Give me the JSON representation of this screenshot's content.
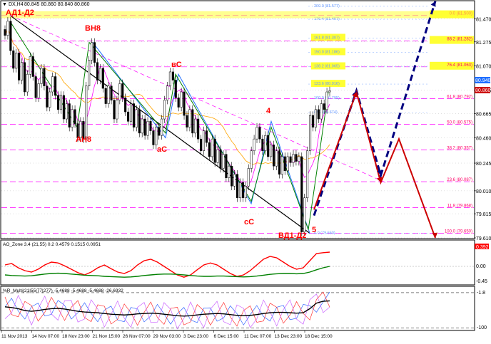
{
  "header": {
    "symbol": "DX,H4",
    "ohlc": "80.845 80.860 80.840 80.860",
    "symbol_icon": "triangle-down-icon"
  },
  "colors": {
    "background": "#ffffff",
    "candle": "#000000",
    "grid": "#c0c0c0",
    "fib_line": "#ff00ff",
    "fib_label": "#ff0066",
    "upper_fib_label": "#6699ff",
    "highlight_yellow": "#ffff33",
    "wave_label": "#ff0000",
    "trend_black": "#000000",
    "trend_blue": "#1e6eff",
    "green_wave": "#008000",
    "projection_blue": "#000080",
    "projection_red": "#cc0000",
    "ma_fast": "#ff00ff",
    "ma_slow": "#ffa500",
    "price_tag": "#1e6eff",
    "price_tag_red": "#cc0000"
  },
  "price_axis": {
    "labels": [
      "81.470",
      "81.275",
      "81.070",
      "80.865",
      "80.665",
      "80.460",
      "80.245",
      "80.010",
      "79.815",
      "79.610"
    ],
    "current_price": "80.940",
    "current_price_red": "80.860"
  },
  "time_axis": {
    "labels": [
      "11 Nov 2013",
      "14 Nov 07:00",
      "18 Nov 23:00",
      "21 Nov 15:00",
      "26 Nov 07:00",
      "29 Nov 03:00",
      "3 Dec 23:00",
      "6 Dec 15:00",
      "11 Dec 07:00",
      "13 Dec 23:00",
      "18 Dec 15:00"
    ]
  },
  "fib_levels": [
    {
      "label": "0.0 (81.500)",
      "highlight": true
    },
    {
      "label": "88.2 (81.282)",
      "highlight": true
    },
    {
      "label": "76.4 (81.063)",
      "highlight": true
    },
    {
      "label": "61.8 (80.792)",
      "highlight": false
    },
    {
      "label": "50.0 (80.575)",
      "highlight": false
    },
    {
      "label": "38.2 (80.357)",
      "highlight": false
    },
    {
      "label": "23.6 (80.087)",
      "highlight": false
    },
    {
      "label": "11.8 (79.868)",
      "highlight": false
    },
    {
      "label": "100.0 (79.650)",
      "highlight": false
    }
  ],
  "upper_fib_levels": [
    {
      "label": "200.0 (81.577)",
      "highlight": false
    },
    {
      "label": "176.4 (81.467)",
      "highlight": false
    },
    {
      "label": "161.8 (81.307)",
      "highlight": true
    },
    {
      "label": "150.0 (81.186)",
      "highlight": true
    },
    {
      "label": "138.2 (81.065)",
      "highlight": true
    },
    {
      "label": "123.6 (80.916)",
      "highlight": true
    },
    {
      "label": "100.0 (80.795)",
      "highlight": false
    },
    {
      "label": "88.2 (80.674)",
      "highlight": false
    },
    {
      "label": "0.0 (79.650)",
      "highlight": false
    }
  ],
  "wave_labels": {
    "ad1d2": "АД1-Д2",
    "bh8": "ВН8",
    "ah8": "АН8",
    "bc": "вС",
    "ac": "аС",
    "cc": "сС",
    "four": "4",
    "five": "5",
    "bd1d2": "ВД1-Д2"
  },
  "ao_panel": {
    "header": "AO_Zone 3.4 (21,55) 0.2 0.4579 0.1515 0.0951",
    "tag_value": "0.392",
    "zero_label": "0.00",
    "low_label": "-0.45"
  },
  "r_panel": {
    "header": "%R_Multi(21|55|77|277) -5.4688 -5.4688 -5.4688 -26.6932",
    "high_label": "-1.8",
    "low_label": "-100"
  },
  "chart_data": {
    "type": "candlestick",
    "series_close": [
      81.33,
      81.45,
      81.2,
      81.05,
      81.18,
      80.95,
      81.1,
      80.85,
      81.0,
      81.15,
      80.98,
      80.8,
      80.92,
      81.05,
      80.9,
      80.72,
      80.85,
      80.98,
      80.82,
      80.7,
      80.82,
      80.62,
      80.75,
      80.55,
      80.7,
      80.58,
      80.46,
      80.6,
      80.45,
      80.9,
      81.12,
      81.27,
      81.1,
      80.95,
      81.05,
      80.88,
      80.75,
      80.9,
      80.78,
      80.62,
      80.78,
      80.92,
      80.8,
      80.68,
      80.6,
      80.75,
      80.55,
      80.7,
      80.5,
      80.62,
      80.48,
      80.6,
      80.52,
      80.4,
      80.55,
      80.48,
      80.62,
      80.78,
      80.9,
      81.02,
      80.95,
      80.8,
      80.72,
      80.85,
      80.65,
      80.55,
      80.7,
      80.5,
      80.62,
      80.45,
      80.35,
      80.52,
      80.42,
      80.3,
      80.45,
      80.25,
      80.36,
      80.2,
      80.32,
      80.12,
      80.22,
      80.05,
      80.15,
      79.95,
      80.08,
      79.95,
      80.05,
      80.2,
      80.35,
      80.45,
      80.55,
      80.45,
      80.35,
      80.48,
      80.3,
      80.4,
      80.22,
      80.35,
      80.15,
      80.3,
      80.18,
      80.3,
      80.25,
      80.32,
      80.26,
      80.3,
      79.66,
      79.95,
      80.35,
      80.65,
      80.55,
      80.7,
      80.62,
      80.75,
      80.7,
      80.85,
      80.86
    ],
    "ylim": [
      79.61,
      81.57
    ],
    "fib_values": [
      81.5,
      81.282,
      81.063,
      80.792,
      80.575,
      80.357,
      80.087,
      79.868,
      79.65
    ],
    "upper_fib_values": [
      81.577,
      81.467,
      81.307,
      81.186,
      81.065,
      80.916,
      80.795,
      80.674,
      79.65
    ],
    "projection_blue": [
      [
        0,
        79.8
      ],
      [
        0.35,
        80.86
      ],
      [
        0.55,
        80.14
      ],
      [
        1,
        81.62
      ]
    ],
    "projection_red": [
      [
        0,
        79.85
      ],
      [
        0.35,
        80.85
      ],
      [
        0.55,
        80.08
      ],
      [
        0.7,
        80.45
      ],
      [
        1,
        79.61
      ]
    ],
    "ao_red": [
      0.05,
      0.1,
      -0.05,
      -0.15,
      -0.2,
      -0.1,
      0.05,
      0.15,
      0.12,
      0.02,
      -0.1,
      -0.22,
      -0.3,
      -0.2,
      -0.05,
      0.05,
      -0.08,
      -0.2,
      -0.25,
      -0.15,
      0.05,
      0.2,
      0.25,
      0.15,
      0.0,
      -0.15,
      -0.3,
      -0.38,
      -0.3,
      -0.12,
      0.05,
      0.12,
      0.05,
      -0.1,
      -0.25,
      -0.35,
      -0.3,
      -0.15,
      0.05,
      0.25,
      0.35,
      0.3,
      0.15,
      0.0,
      -0.1,
      -0.05,
      0.2,
      0.45,
      0.48,
      0.5
    ],
    "ao_green": [
      -0.3,
      -0.32,
      -0.33,
      -0.34,
      -0.33,
      -0.3,
      -0.27,
      -0.25,
      -0.24,
      -0.25,
      -0.27,
      -0.29,
      -0.31,
      -0.32,
      -0.33,
      -0.35,
      -0.36,
      -0.37,
      -0.38,
      -0.37,
      -0.35,
      -0.32,
      -0.3,
      -0.28,
      -0.27,
      -0.27,
      -0.28,
      -0.3,
      -0.32,
      -0.34,
      -0.35,
      -0.35,
      -0.34,
      -0.34,
      -0.35,
      -0.36,
      -0.37,
      -0.36,
      -0.34,
      -0.31,
      -0.28,
      -0.26,
      -0.25,
      -0.25,
      -0.26,
      -0.25,
      -0.2,
      -0.12,
      -0.05,
      0.0
    ],
    "r_black": [
      -40,
      -42,
      -45,
      -50,
      -52,
      -50,
      -47,
      -45,
      -44,
      -46,
      -49,
      -52,
      -54,
      -55,
      -56,
      -58,
      -60,
      -61,
      -62,
      -61,
      -59,
      -58,
      -57,
      -58,
      -60,
      -62,
      -64,
      -65,
      -64,
      -62,
      -60,
      -59,
      -58,
      -59,
      -61,
      -63,
      -64,
      -63,
      -61,
      -58,
      -56,
      -55,
      -55,
      -56,
      -57,
      -56,
      -45,
      -30,
      -25,
      -24
    ]
  }
}
